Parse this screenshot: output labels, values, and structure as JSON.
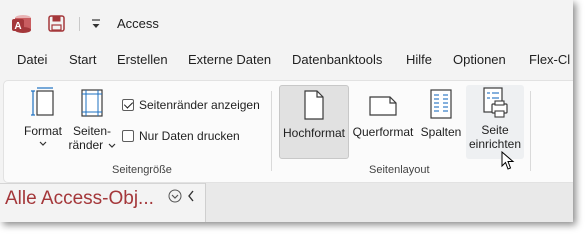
{
  "window": {
    "title": "Access"
  },
  "colors": {
    "access_brand": "#a4373a",
    "save_icon": "#a4373a"
  },
  "menu": {
    "tabs": [
      {
        "label": "Datei"
      },
      {
        "label": "Start"
      },
      {
        "label": "Erstellen"
      },
      {
        "label": "Externe Daten"
      },
      {
        "label": "Datenbanktools"
      },
      {
        "label": "Hilfe"
      },
      {
        "label": "Optionen"
      },
      {
        "label": "Flex-Cl"
      }
    ]
  },
  "ribbon": {
    "group_size": {
      "label": "Seitengröße",
      "format_label": "Format",
      "margins_label_1": "Seiten-",
      "margins_label_2": "ränder",
      "show_margins": {
        "label": "Seitenränder anzeigen",
        "checked": true
      },
      "data_only": {
        "label": "Nur Daten drucken",
        "checked": false
      }
    },
    "group_layout": {
      "label": "Seitenlayout",
      "portrait_label": "Hochformat",
      "landscape_label": "Querformat",
      "columns_label": "Spalten",
      "page_setup_label_1": "Seite",
      "page_setup_label_2": "einrichten"
    }
  },
  "nav_pane": {
    "title": "Alle Access-Obj..."
  }
}
